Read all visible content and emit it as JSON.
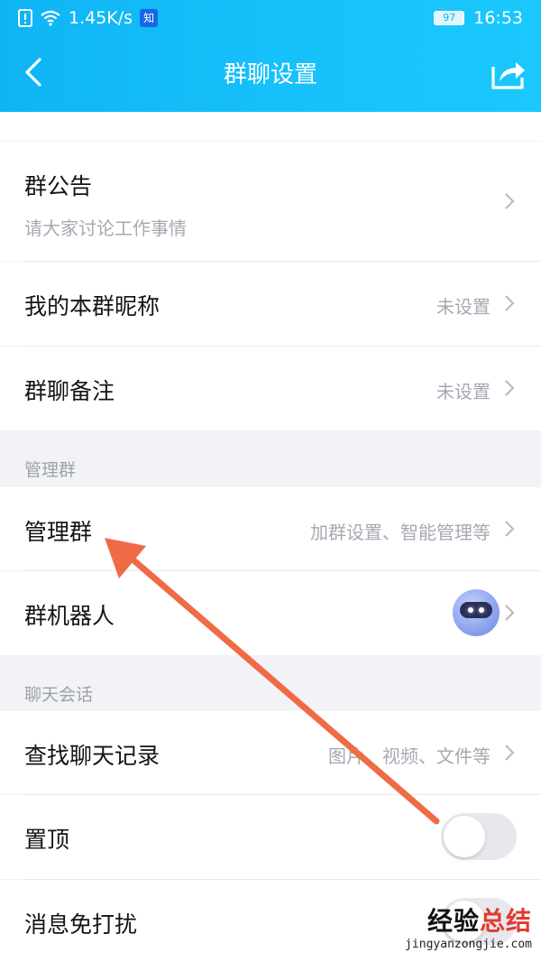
{
  "status_bar": {
    "speed": "1.45K/s",
    "app_badge": "知",
    "battery": "97",
    "time": "16:53"
  },
  "nav": {
    "title": "群聊设置"
  },
  "rows": {
    "announcement": {
      "label": "群公告",
      "subtitle": "请大家讨论工作事情"
    },
    "my_nickname": {
      "label": "我的本群昵称",
      "value": "未设置"
    },
    "group_remark": {
      "label": "群聊备注",
      "value": "未设置"
    },
    "manage_group": {
      "label": "管理群",
      "value": "加群设置、智能管理等"
    },
    "group_robot": {
      "label": "群机器人"
    },
    "search_history": {
      "label": "查找聊天记录",
      "value": "图片、视频、文件等"
    },
    "pin_top": {
      "label": "置顶",
      "toggle_on": false
    },
    "do_not_disturb": {
      "label": "消息免打扰",
      "toggle_on": false
    }
  },
  "sections": {
    "manage": "管理群",
    "chat": "聊天会话"
  },
  "watermark": {
    "text_black": "经验",
    "text_red": "总结",
    "url": "jingyanzongjie.com"
  },
  "colors": {
    "header_start": "#0fb4f4",
    "header_end": "#1ac8fd",
    "annotation_arrow": "#f06b45"
  }
}
